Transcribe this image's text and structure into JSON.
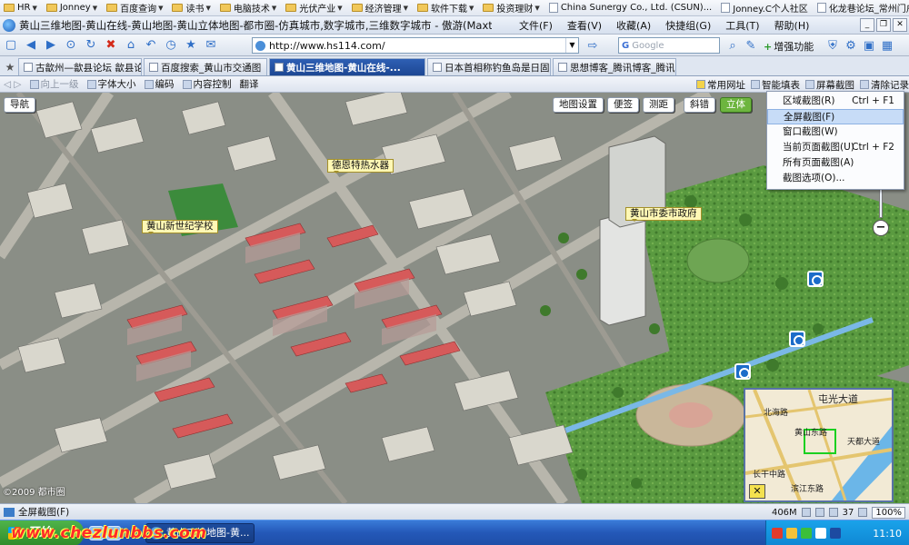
{
  "bookmarks": [
    {
      "label": "HR",
      "kind": "folder"
    },
    {
      "label": "Jonney",
      "kind": "folder"
    },
    {
      "label": "百度查询",
      "kind": "folder"
    },
    {
      "label": "读书",
      "kind": "folder"
    },
    {
      "label": "电脑技术",
      "kind": "folder"
    },
    {
      "label": "光伏产业",
      "kind": "folder"
    },
    {
      "label": "经济管理",
      "kind": "folder"
    },
    {
      "label": "软件下载",
      "kind": "folder"
    },
    {
      "label": "投资理财",
      "kind": "folder"
    },
    {
      "label": "China Sunergy Co., Ltd. (CSUN)...",
      "kind": "page"
    },
    {
      "label": "Jonney.C个人社区",
      "kind": "page"
    },
    {
      "label": "化龙巷论坛_常州门户_化龙巷",
      "kind": "page"
    }
  ],
  "window": {
    "title": "黄山三维地图-黄山在线-黄山地图-黄山立体地图-都市圈-仿真城市,数字城市,三维数字城市 - 傲游(Maxthon) 2.5.1",
    "menus": [
      "文件(F)",
      "查看(V)",
      "收藏(A)",
      "快捷组(G)",
      "工具(T)",
      "帮助(H)"
    ]
  },
  "navbar": {
    "address": "http://www.hs114.com/",
    "search_placeholder": "Google",
    "search_engine": "G",
    "enhance_label": "增强功能"
  },
  "tabs": [
    {
      "label": "古歙州—歙县论坛 歙县论坛|古...",
      "active": false
    },
    {
      "label": "百度搜索_黄山市交通图",
      "active": false
    },
    {
      "label": "黄山三维地图-黄山在线-...",
      "active": true
    },
    {
      "label": "日本首相称钓鱼岛是日固有...",
      "active": false
    },
    {
      "label": "思想博客_腾讯博客_腾讯网",
      "active": false
    }
  ],
  "subbar": {
    "up_label": "向上一级",
    "items": [
      "字体大小",
      "编码",
      "内容控制",
      "翻译"
    ],
    "right_items": [
      "常用网址",
      "智能填表",
      "屏幕截图",
      "清除记录"
    ]
  },
  "map": {
    "buttons": {
      "nav": "导航",
      "settings": "地图设置",
      "note": "便签",
      "measure": "测距",
      "oblique": "斜错",
      "stereo": "立体"
    },
    "pois": [
      "德恩特热水器",
      "黄山新世纪学校",
      "黄山市委市政府"
    ],
    "copyright": "©2009 都市圈",
    "zoom_plus": "+",
    "zoom_minus": "−"
  },
  "overview": {
    "labels": [
      "屯光大道",
      "北海路",
      "黄山东路",
      "天都大道",
      "长干中路",
      "滨江东路"
    ],
    "scale_btn": "✕"
  },
  "context_menu": {
    "items": [
      {
        "label": "区域截图(R)",
        "shortcut": "Ctrl + F1",
        "highlighted": false
      },
      {
        "label": "全屏截图(F)",
        "shortcut": "",
        "highlighted": true
      },
      {
        "label": "窗口截图(W)",
        "shortcut": "",
        "highlighted": false
      },
      {
        "label": "当前页面截图(U)",
        "shortcut": "Ctrl + F2",
        "highlighted": false
      },
      {
        "label": "所有页面截图(A)",
        "shortcut": "",
        "highlighted": false
      },
      {
        "label": "截图选项(O)...",
        "shortcut": "",
        "highlighted": false
      }
    ]
  },
  "status": {
    "text": "全屏截图(F)",
    "memory": "406M",
    "zoom": "100%",
    "count": "37"
  },
  "taskbar": {
    "start": "开始",
    "task_label": "黄山三维地图-黄...",
    "clock": "11:10"
  },
  "watermark": "www.chezlunbbs.com",
  "colors": {
    "active_tab": "#2458b8",
    "roof_red": "#d84a4a",
    "grass": "#4f8f3a",
    "taskbar": "#245edb"
  }
}
